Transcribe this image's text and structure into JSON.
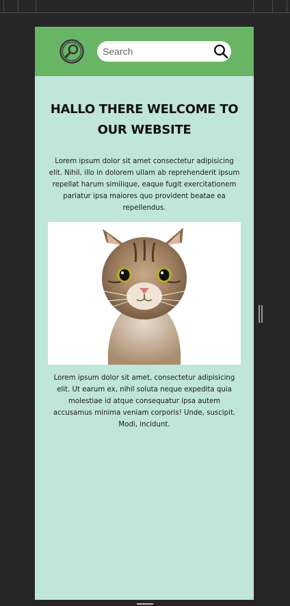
{
  "search": {
    "placeholder": "Search"
  },
  "main": {
    "headline": "HALLO THERE WELCOME TO OUR WEBSITE",
    "paragraph_1": "Lorem ipsum dolor sit amet consectetur adipisicing elit. Nihil, illo in dolorem ullam ab reprehenderit ipsum repellat harum similique, eaque fugit exercitationem pariatur ipsa maiores quo provident beatae ea repellendus.",
    "paragraph_2": "Lorem ipsum dolor sit amet, consectetur adipisicing elit. Ut earum ex, nihil soluta neque expedita quia molestiae id atque consequatur ipsa autem accusamus minima veniam corporis! Unde, suscipit. Modi, incidunt.",
    "image_icon": "cat-photo"
  },
  "colors": {
    "header_bg": "#68b565",
    "page_bg": "#c0e5d9",
    "chrome_bg": "#262626"
  },
  "icons": {
    "logo": "magnifier-logo-icon",
    "search": "search-icon"
  }
}
